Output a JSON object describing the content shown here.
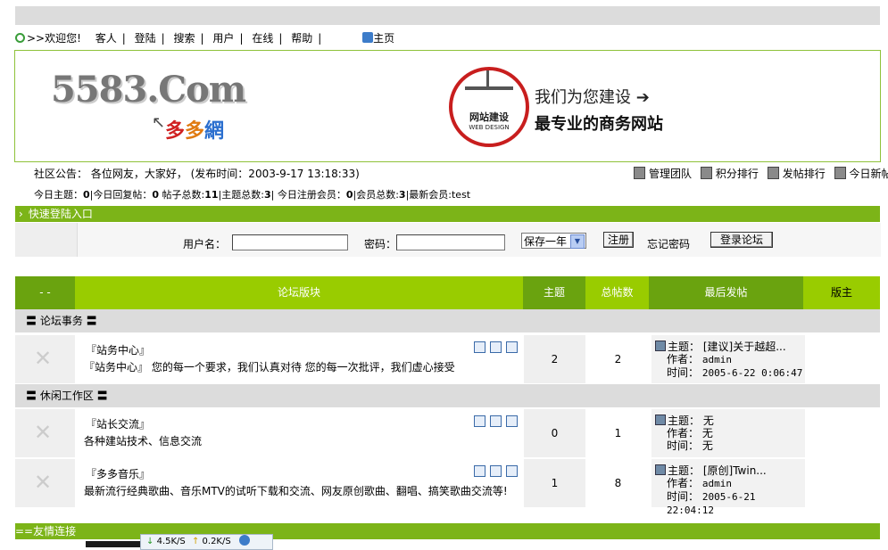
{
  "nav": {
    "welcome": ">>欢迎您!",
    "items": [
      "客人",
      "登陆",
      "搜索",
      "用户",
      "在线",
      "帮助"
    ],
    "home": "主页"
  },
  "banner": {
    "logo": "5583.Com",
    "logo_sub": [
      "多",
      "多",
      "網"
    ],
    "seal_text": "网站建设",
    "seal_sub": "WEB DESIGN",
    "slogan1": "我们为您建设 ➔",
    "slogan2": "最专业的商务网站"
  },
  "notice": "社区公告： 各位网友，大家好， (发布时间：2003-9-17 13:18:33)",
  "top_links": [
    "管理团队",
    "积分排行",
    "发帖排行",
    "今日新帖"
  ],
  "stats": {
    "today_posts_label": "今日主题：",
    "today_posts": "0",
    "today_replies_label": "|今日回复帖：",
    "today_replies": "0",
    "total_posts_label": " 帖子总数:",
    "total_posts": "11",
    "topics_label": "|主题总数:",
    "topics": "3",
    "today_reg_label": "| 今日注册会员：",
    "today_reg": "0",
    "members_label": "|会员总数:",
    "members": "3",
    "newest_label": "|最新会员:",
    "newest": "test"
  },
  "login": {
    "bar_label": "快速登陆入口",
    "username_label": "用户名：",
    "password_label": "密码：",
    "remember_option": "保存一年",
    "register_button": "注册",
    "forgot": "忘记密码",
    "submit_button": "登录论坛"
  },
  "table_header": {
    "col1": "- -",
    "col2": "论坛版块",
    "col3": "主题",
    "col4": "总帖数",
    "col5": "最后发帖",
    "col6": "版主"
  },
  "sections": [
    {
      "title": "〓 论坛事务 〓"
    },
    {
      "title": "〓 休闲工作区 〓"
    }
  ],
  "forums": [
    {
      "title": "『站务中心』",
      "desc": "『站务中心』 您的每一个要求，我们认真对待    您的每一次批评，我们虚心接受",
      "topics": "2",
      "posts": "2",
      "last_topic": "[建议]关于越超...",
      "last_author": "admin",
      "last_time": "2005-6-22 0:06:47"
    },
    {
      "title": "『站长交流』",
      "desc": "各种建站技术、信息交流",
      "topics": "0",
      "posts": "1",
      "last_topic": "无",
      "last_author": "无",
      "last_time": "无"
    },
    {
      "title": "『多多音乐』",
      "desc": "最新流行经典歌曲、音乐MTV的试听下载和交流、网友原创歌曲、翻唱、搞笑歌曲交流等!",
      "topics": "1",
      "posts": "8",
      "last_topic": "[原创]Twin...",
      "last_author": "admin",
      "last_time": "2005-6-21 22:04:12"
    }
  ],
  "last_labels": {
    "topic": "主题：",
    "author": "作者：",
    "time": "时间："
  },
  "friend_bar": "==友情连接",
  "tray": {
    "down": "4.5K/S",
    "up": "0.2K/S"
  },
  "colors": {
    "green": "#7cb418",
    "header_light": "#99cc00",
    "header_dark": "#6aa30f"
  }
}
